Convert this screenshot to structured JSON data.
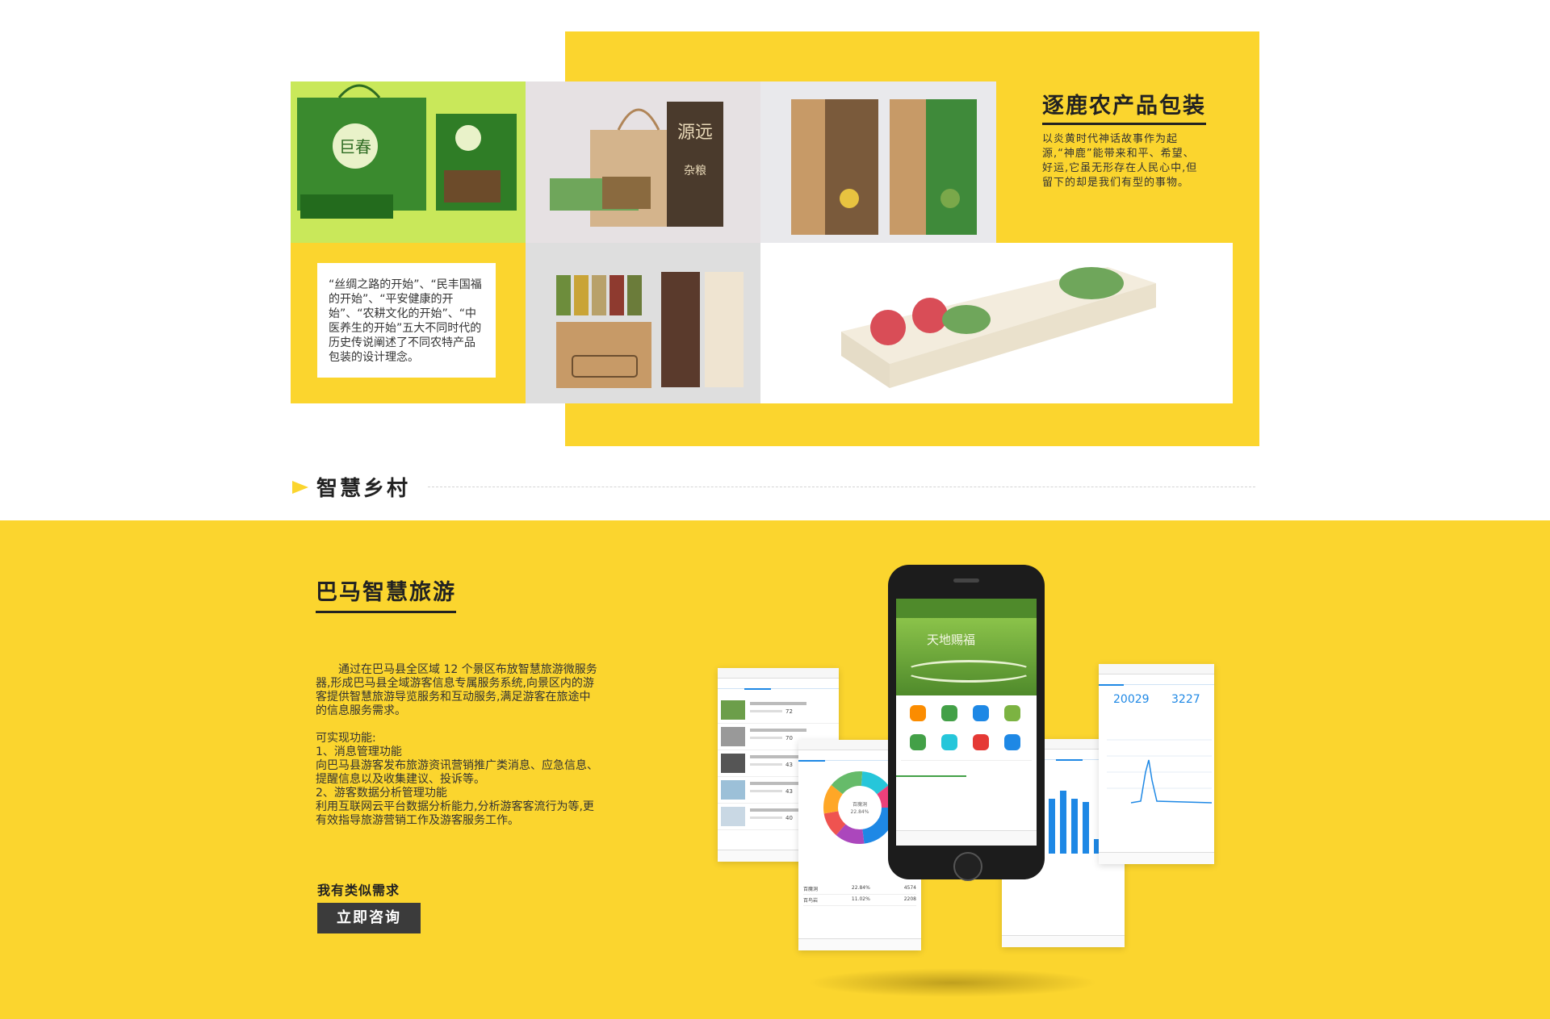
{
  "packaging": {
    "title": "逐鹿农产品包装",
    "description": "以炎黄时代神话故事作为起源,“神鹿”能带来和平、希望、好运,它虽无形存在人民心中,但留下的却是我们有型的事物。",
    "note": "“丝绸之路的开始”、“民丰国福的开始”、“平安健康的开始”、“农耕文化的开始”、“中医养生的开始”五大不同时代的历史传说阐述了不同农特产品包装的设计理念。",
    "product_labels": {
      "box_brand_a": "巨春",
      "box_brand_b": "源远",
      "box_type": "杂粮"
    }
  },
  "section": {
    "title": "智慧乡村"
  },
  "tourism": {
    "title": "巴马智慧旅游",
    "intro": "通过在巴马县全区域 12 个景区布放智慧旅游微服务器,形成巴马县全域游客信息专属服务系统,向景区内的游客提供智慧旅游导览服务和互动服务,满足游客在旅途中的信息服务需求。",
    "features_heading": "可实现功能:",
    "feature1_title": "1、消息管理功能",
    "feature1_desc": "向巴马县游客发布旅游资讯营销推广类消息、应急信息、提醒信息以及收集建议、投诉等。",
    "feature2_title": "2、游客数据分析管理功能",
    "feature2_desc": "利用互联网云平台数据分析能力,分析游客客流行为等,更有效指导旅游营销工作及游客服务工作。",
    "need_label": "我有类似需求",
    "consult_button": "立即咨询"
  },
  "phone_screens": {
    "center_banner_text": "天地赐福",
    "left_panel_nums": [
      "72",
      "70",
      "43",
      "43",
      "40"
    ],
    "right_stats": {
      "today": "20029",
      "realtime": "3227"
    },
    "pie_center_label": "百魔洞",
    "pie_center_pct": "22.84%",
    "pie_table": [
      {
        "name": "百魔洞",
        "pct": "22.84%",
        "count": "4574"
      },
      {
        "name": "百鸟岩",
        "pct": "11.02%",
        "count": "2208"
      }
    ],
    "accent_color": "#1e88e5"
  },
  "colors": {
    "brand_yellow": "#fbd52e",
    "button_dark": "#3b3b3b"
  }
}
